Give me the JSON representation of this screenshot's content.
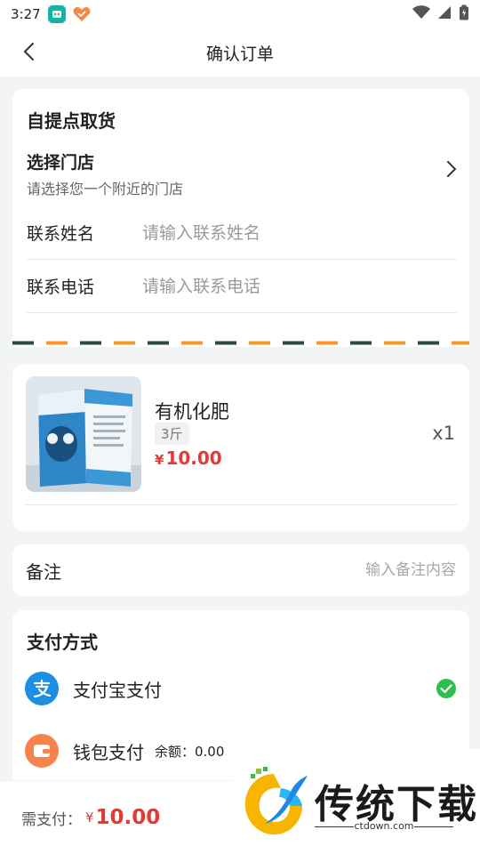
{
  "status_bar": {
    "time": "3:27"
  },
  "nav": {
    "title": "确认订单"
  },
  "pickup": {
    "title": "自提点取货",
    "store_title": "选择门店",
    "store_subtitle": "请选择您一个附近的门店",
    "name_label": "联系姓名",
    "name_placeholder": "请输入联系姓名",
    "phone_label": "联系电话",
    "phone_placeholder": "请输入联系电话"
  },
  "product": {
    "name": "有机化肥",
    "spec": "3斤",
    "price_symbol": "¥",
    "price": "10.00",
    "quantity": "x1"
  },
  "remark": {
    "label": "备注",
    "placeholder": "输入备注内容"
  },
  "payment": {
    "title": "支付方式",
    "options": [
      {
        "label": "支付宝支付",
        "icon": "alipay-icon",
        "selected": true
      },
      {
        "label": "钱包支付",
        "icon": "wallet-icon",
        "balance_text": "余额：0.00",
        "selected": false
      }
    ]
  },
  "footer": {
    "total_label": "需支付：",
    "total_symbol": "¥",
    "total_amount": "10.00"
  },
  "watermark": {
    "text": "传统下载",
    "url": "ctdown.com"
  },
  "colors": {
    "accent_red": "#e53935",
    "check_green": "#2fbf4e",
    "alipay_blue": "#1a8fe3",
    "wallet_orange": "#f6844a",
    "edge_dark": "#2d4a3e",
    "edge_orange": "#f39a2b"
  }
}
